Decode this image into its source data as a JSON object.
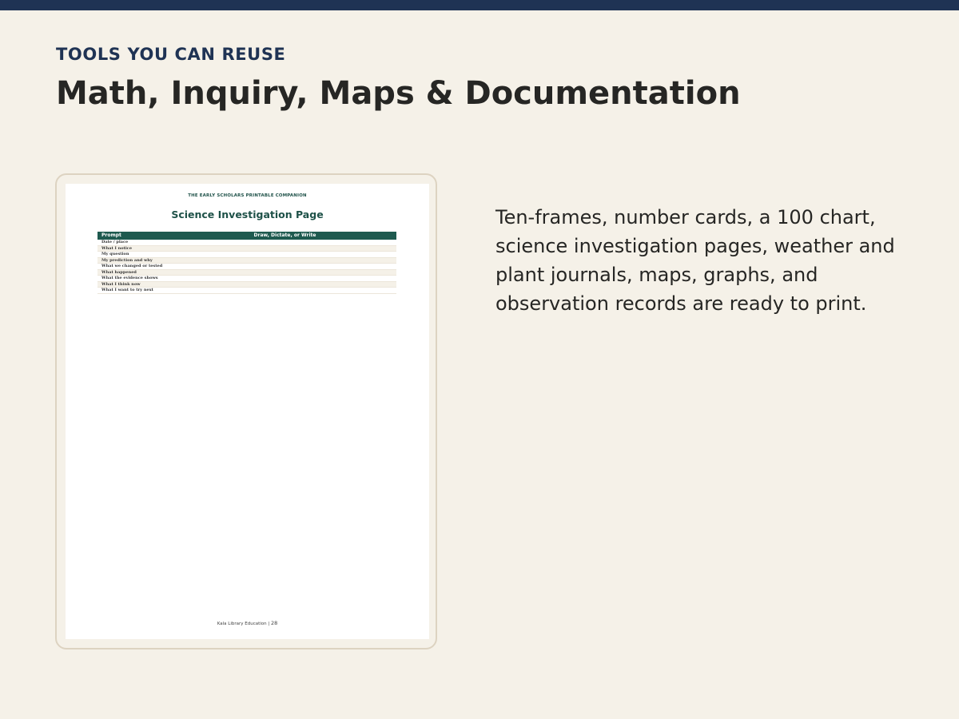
{
  "slide": {
    "eyebrow": "TOOLS YOU CAN REUSE",
    "title": "Math, Inquiry, Maps & Documentation",
    "description": "Ten-frames, number cards, a 100 chart, science investigation pages, weather and plant journals, maps, graphs, and observation records are ready to print."
  },
  "document": {
    "header": "THE EARLY SCHOLARS PRINTABLE COMPANION",
    "title": "Science Investigation Page",
    "table": {
      "columns": [
        "Prompt",
        "Draw, Dictate, or Write"
      ],
      "rows": [
        "Date / place",
        "What I notice",
        "My question",
        "My prediction and why",
        "What we changed or tested",
        "What happened",
        "What the evidence shows",
        "What I think now",
        "What I want to try next"
      ]
    },
    "footer": {
      "publisher": "Kala Library Education",
      "separator": "|",
      "page_number": "28"
    }
  },
  "colors": {
    "background": "#f5f1e8",
    "top_bar": "#1f3354",
    "eyebrow": "#1f3354",
    "doc_accent": "#1e5a4f"
  }
}
